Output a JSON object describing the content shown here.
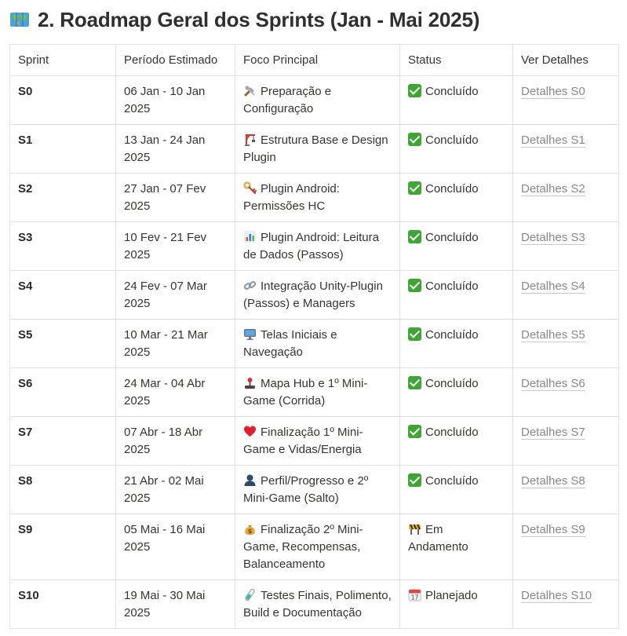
{
  "heading": {
    "icon": "world-map-icon",
    "text": "2. Roadmap Geral dos Sprints (Jan - Mai 2025)"
  },
  "table": {
    "headers": [
      "Sprint",
      "Período Estimado",
      "Foco Principal",
      "Status",
      "Ver Detalhes"
    ],
    "rows": [
      {
        "sprint": "S0",
        "period": "06 Jan - 10 Jan 2025",
        "focus_icon": "tools-icon",
        "focus": "Preparação e Configuração",
        "status_icon": "check-icon",
        "status": "Concluído",
        "details": "Detalhes S0"
      },
      {
        "sprint": "S1",
        "period": "13 Jan - 24 Jan 2025",
        "focus_icon": "construction-crane-icon",
        "focus": "Estrutura Base e Design Plugin",
        "status_icon": "check-icon",
        "status": "Concluído",
        "details": "Detalhes S1"
      },
      {
        "sprint": "S2",
        "period": "27 Jan - 07 Fev 2025",
        "focus_icon": "key-icon",
        "focus": "Plugin Android: Permissões HC",
        "status_icon": "check-icon",
        "status": "Concluído",
        "details": "Detalhes S2"
      },
      {
        "sprint": "S3",
        "period": "10 Fev - 21 Fev 2025",
        "focus_icon": "bar-chart-icon",
        "focus": "Plugin Android: Leitura de Dados (Passos)",
        "status_icon": "check-icon",
        "status": "Concluído",
        "details": "Detalhes S3"
      },
      {
        "sprint": "S4",
        "period": "24 Fev - 07 Mar 2025",
        "focus_icon": "link-icon",
        "focus": "Integração Unity-Plugin (Passos) e Managers",
        "status_icon": "check-icon",
        "status": "Concluído",
        "details": "Detalhes S4"
      },
      {
        "sprint": "S5",
        "period": "10 Mar - 21 Mar 2025",
        "focus_icon": "monitor-icon",
        "focus": "Telas Iniciais e Navegação",
        "status_icon": "check-icon",
        "status": "Concluído",
        "details": "Detalhes S5"
      },
      {
        "sprint": "S6",
        "period": "24 Mar - 04 Abr 2025",
        "focus_icon": "joystick-icon",
        "focus": "Mapa Hub e 1º Mini-Game (Corrida)",
        "status_icon": "check-icon",
        "status": "Concluído",
        "details": "Detalhes S6"
      },
      {
        "sprint": "S7",
        "period": "07 Abr - 18 Abr 2025",
        "focus_icon": "heart-icon",
        "focus": "Finalização 1º Mini-Game e Vidas/Energia",
        "status_icon": "check-icon",
        "status": "Concluído",
        "details": "Detalhes S7"
      },
      {
        "sprint": "S8",
        "period": "21 Abr - 02 Mai 2025",
        "focus_icon": "user-icon",
        "focus": "Perfil/Progresso e 2º Mini-Game (Salto)",
        "status_icon": "check-icon",
        "status": "Concluído",
        "details": "Detalhes S8"
      },
      {
        "sprint": "S9",
        "period": "05 Mai - 16 Mai 2025",
        "focus_icon": "money-bag-icon",
        "focus": "Finalização 2º Mini-Game, Recompensas, Balanceamento",
        "status_icon": "construction-barrier-icon",
        "status": "Em Andamento",
        "details": "Detalhes S9"
      },
      {
        "sprint": "S10",
        "period": "19 Mai - 30 Mai 2025",
        "focus_icon": "test-tube-icon",
        "focus": "Testes Finais, Polimento, Build e Documentação",
        "status_icon": "calendar-icon",
        "status": "Planejado",
        "details": "Detalhes S10"
      }
    ]
  }
}
